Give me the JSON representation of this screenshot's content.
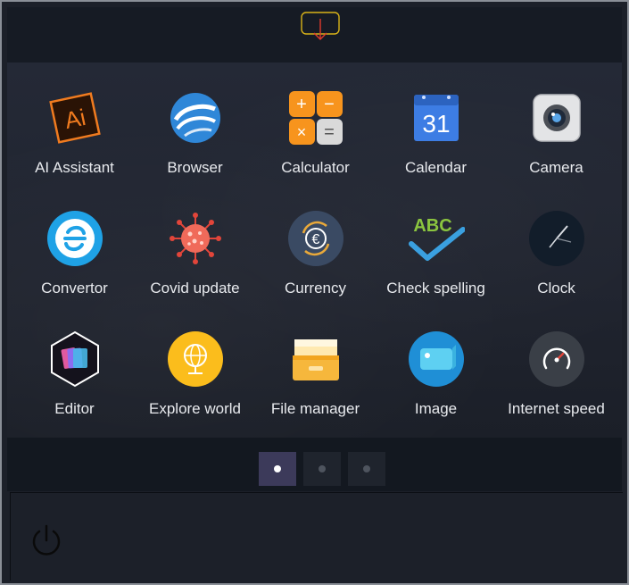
{
  "apps": [
    {
      "label": "AI Assistant",
      "icon": "ai-assistant-icon"
    },
    {
      "label": "Browser",
      "icon": "browser-icon"
    },
    {
      "label": "Calculator",
      "icon": "calculator-icon"
    },
    {
      "label": "Calendar",
      "icon": "calendar-icon",
      "day": "31"
    },
    {
      "label": "Camera",
      "icon": "camera-icon"
    },
    {
      "label": "Convertor",
      "icon": "convertor-icon"
    },
    {
      "label": "Covid update",
      "icon": "covid-icon"
    },
    {
      "label": "Currency",
      "icon": "currency-icon"
    },
    {
      "label": "Check spelling",
      "icon": "check-spelling-icon",
      "badge": "ABC"
    },
    {
      "label": "Clock",
      "icon": "clock-icon"
    },
    {
      "label": "Editor",
      "icon": "editor-icon"
    },
    {
      "label": "Explore world",
      "icon": "globe-icon"
    },
    {
      "label": "File manager",
      "icon": "file-cabinet-icon"
    },
    {
      "label": "Image",
      "icon": "image-icon"
    },
    {
      "label": "Internet speed",
      "icon": "speedometer-icon"
    }
  ],
  "pager": {
    "pages": 3,
    "active": 1
  },
  "colors": {
    "accent_collapse": "#d9b318",
    "arrow": "#e03a2c",
    "active_page": "#3c3a5a"
  }
}
